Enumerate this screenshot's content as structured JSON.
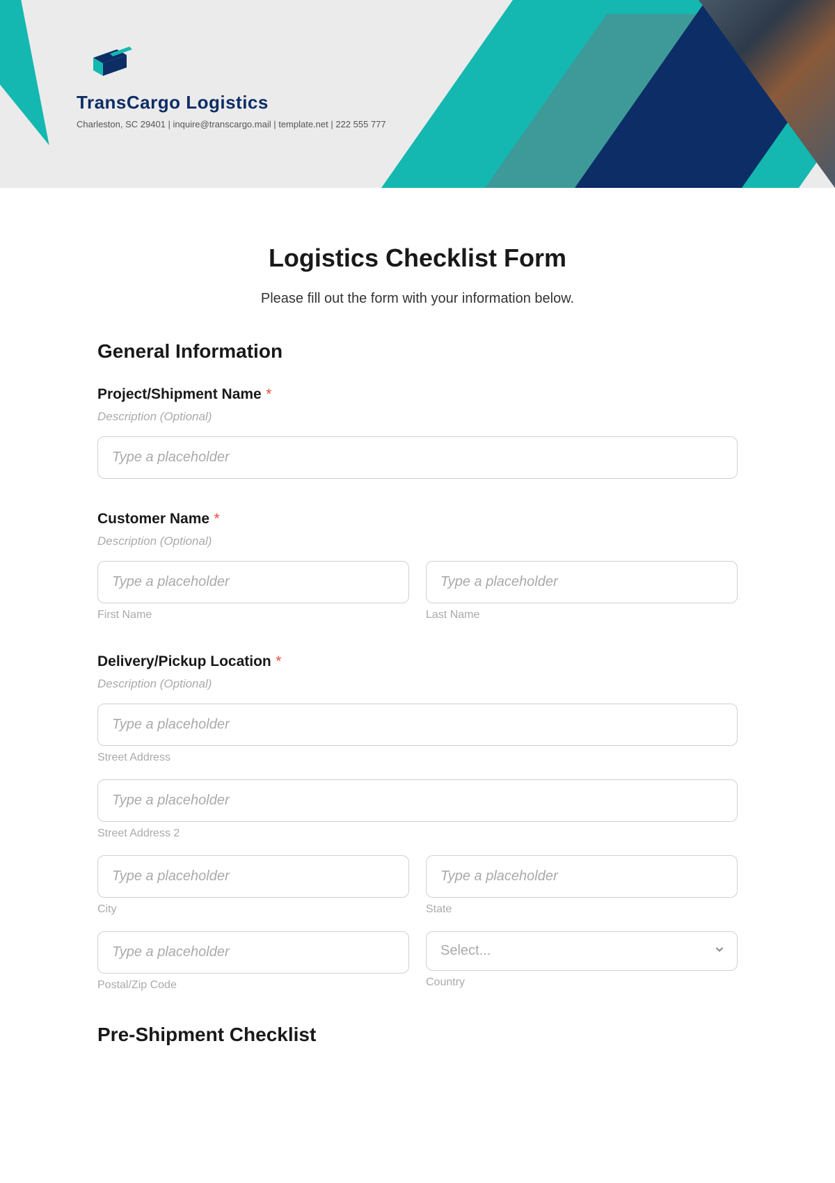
{
  "header": {
    "company_name": "TransCargo Logistics",
    "subtitle": "Charleston, SC 29401 | inquire@transcargo.mail | template.net | 222 555 777"
  },
  "form": {
    "title": "Logistics Checklist Form",
    "instructions": "Please fill out the form with your information below.",
    "sections": {
      "general": {
        "heading": "General Information",
        "project_name": {
          "label": "Project/Shipment Name",
          "required_marker": "*",
          "description": "Description (Optional)",
          "placeholder": "Type a placeholder"
        },
        "customer_name": {
          "label": "Customer Name",
          "required_marker": "*",
          "description": "Description (Optional)",
          "first_placeholder": "Type a placeholder",
          "first_sublabel": "First Name",
          "last_placeholder": "Type a placeholder",
          "last_sublabel": "Last Name"
        },
        "location": {
          "label": "Delivery/Pickup Location",
          "required_marker": "*",
          "description": "Description (Optional)",
          "street1_placeholder": "Type a placeholder",
          "street1_sublabel": "Street Address",
          "street2_placeholder": "Type a placeholder",
          "street2_sublabel": "Street Address 2",
          "city_placeholder": "Type a placeholder",
          "city_sublabel": "City",
          "state_placeholder": "Type a placeholder",
          "state_sublabel": "State",
          "postal_placeholder": "Type a placeholder",
          "postal_sublabel": "Postal/Zip Code",
          "country_placeholder": "Select...",
          "country_sublabel": "Country"
        }
      },
      "preshipment": {
        "heading": "Pre-Shipment Checklist"
      }
    }
  }
}
